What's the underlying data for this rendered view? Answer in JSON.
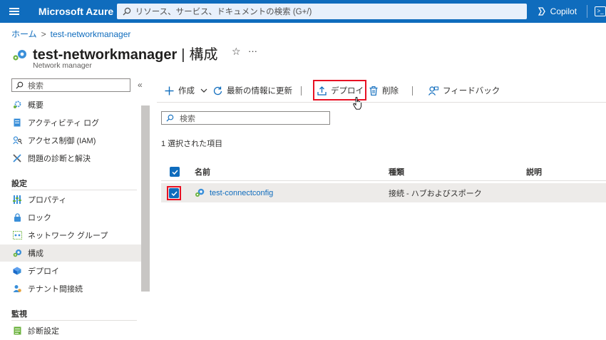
{
  "topbar": {
    "brand": "Microsoft Azure",
    "search_placeholder": "リソース、サービス、ドキュメントの検索 (G+/)",
    "copilot": "Copilot",
    "accent": "#0f6cbd"
  },
  "breadcrumb": {
    "home": "ホーム",
    "chevron": ">",
    "current": "test-networkmanager"
  },
  "header": {
    "resource_name": "test-networkmanager",
    "separator": "|",
    "section": "構成",
    "subtitle": "Network manager",
    "star": "☆",
    "more": "···"
  },
  "sidebar": {
    "search_placeholder": "検索",
    "collapse": "«",
    "items": [
      {
        "label": "概要",
        "icon": "overview-icon"
      },
      {
        "label": "アクティビティ ログ",
        "icon": "activity-log-icon"
      },
      {
        "label": "アクセス制御 (IAM)",
        "icon": "iam-icon"
      },
      {
        "label": "問題の診断と解決",
        "icon": "diagnose-icon"
      }
    ],
    "section_settings": "設定",
    "settings_items": [
      {
        "label": "プロパティ",
        "icon": "properties-icon"
      },
      {
        "label": "ロック",
        "icon": "lock-icon"
      },
      {
        "label": "ネットワーク グループ",
        "icon": "network-group-icon"
      },
      {
        "label": "構成",
        "icon": "configuration-icon"
      },
      {
        "label": "デプロイ",
        "icon": "deploy-icon"
      },
      {
        "label": "テナント間接続",
        "icon": "tenant-icon"
      }
    ],
    "section_monitoring": "監視",
    "monitoring_items": [
      {
        "label": "診断設定",
        "icon": "diagnostic-settings-icon"
      }
    ]
  },
  "toolbar": {
    "create": "作成",
    "refresh": "最新の情報に更新",
    "deploy": "デプロイ",
    "delete": "削除",
    "feedback": "フィードバック"
  },
  "filter": {
    "placeholder": "検索"
  },
  "selection": {
    "count_text": "1 選択された項目"
  },
  "grid": {
    "columns": [
      "名前",
      "種類",
      "説明"
    ],
    "rows": [
      {
        "name": "test-connectconfig",
        "type": "接続 - ハブおよびスポーク",
        "description": "",
        "selected": true
      }
    ]
  }
}
